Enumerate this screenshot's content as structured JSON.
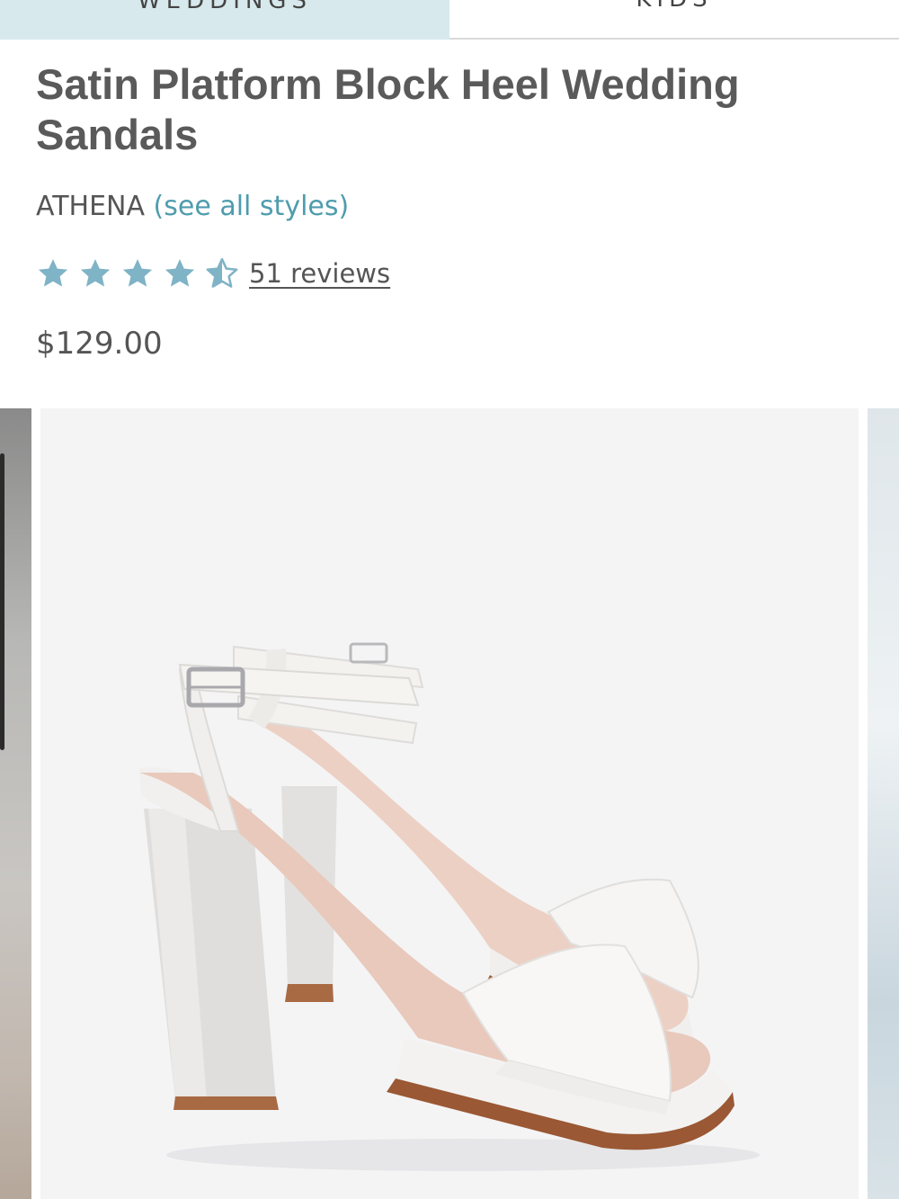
{
  "tabs": [
    {
      "label": "WEDDINGS"
    },
    {
      "label": "KIDS"
    }
  ],
  "product": {
    "title": "Satin Platform Block Heel Wedding Sandals",
    "brand": "ATHENA",
    "brand_link": "(see all styles)",
    "rating": 4.5,
    "rating_max": 5,
    "reviews_label": "51 reviews",
    "price": "$129.00"
  },
  "colors": {
    "tab_active_bg": "#d7e9ed",
    "star": "#7fb3c6",
    "link": "#4f9cad",
    "text": "#555555"
  },
  "icons": {
    "star_full": "star-icon",
    "star_half": "star-half-icon"
  },
  "carousel": {
    "main_image": "white satin platform block heel sandals with ankle straps"
  }
}
